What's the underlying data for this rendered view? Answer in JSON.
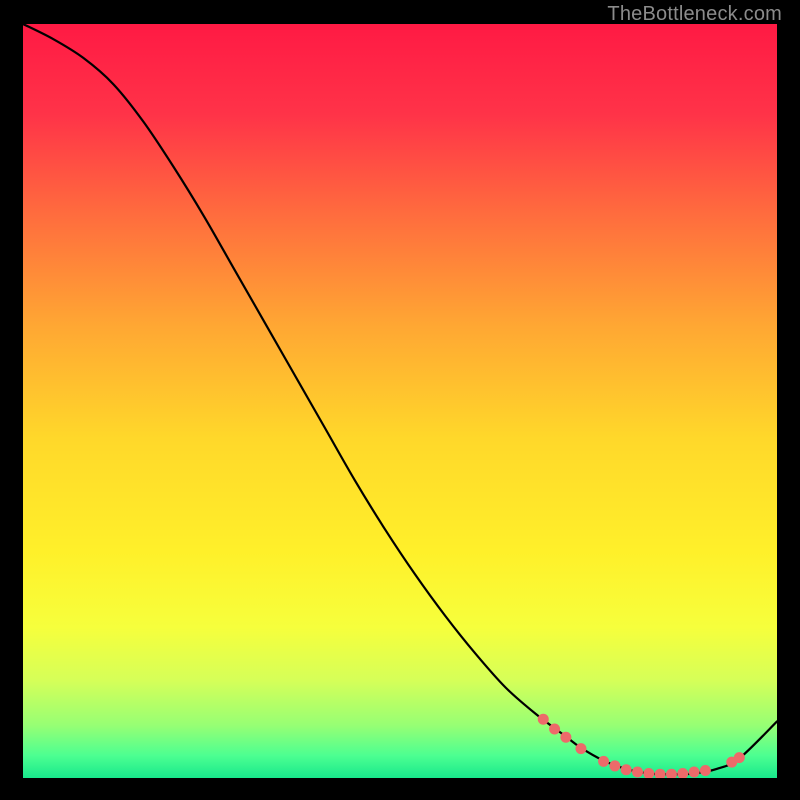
{
  "watermark": "TheBottleneck.com",
  "chart_data": {
    "type": "line",
    "title": "",
    "xlabel": "",
    "ylabel": "",
    "xlim": [
      0,
      100
    ],
    "ylim": [
      0,
      100
    ],
    "background_gradient": [
      {
        "pos": 0.0,
        "color": "#ff1a44"
      },
      {
        "pos": 0.12,
        "color": "#ff3348"
      },
      {
        "pos": 0.25,
        "color": "#ff6b3e"
      },
      {
        "pos": 0.4,
        "color": "#ffa733"
      },
      {
        "pos": 0.55,
        "color": "#ffd82a"
      },
      {
        "pos": 0.7,
        "color": "#fff02a"
      },
      {
        "pos": 0.8,
        "color": "#f6ff3c"
      },
      {
        "pos": 0.87,
        "color": "#d6ff58"
      },
      {
        "pos": 0.93,
        "color": "#97ff74"
      },
      {
        "pos": 0.97,
        "color": "#4dff91"
      },
      {
        "pos": 1.0,
        "color": "#18e88c"
      }
    ],
    "series": [
      {
        "name": "curve",
        "color": "#000000",
        "width": 2.2,
        "x": [
          0,
          4,
          8,
          12,
          16,
          20,
          24,
          28,
          32,
          36,
          40,
          44,
          48,
          52,
          56,
          60,
          64,
          68,
          72,
          74,
          77,
          80,
          83,
          86,
          89,
          92,
          95,
          100
        ],
        "y": [
          100,
          98,
          95.5,
          92,
          87,
          81,
          74.5,
          67.5,
          60.5,
          53.5,
          46.5,
          39.5,
          33,
          27,
          21.5,
          16.5,
          12,
          8.5,
          5.5,
          4,
          2.3,
          1.2,
          0.6,
          0.5,
          0.6,
          1.2,
          2.6,
          7.5
        ]
      }
    ],
    "marker_series": {
      "name": "highlight-dots",
      "color": "#ed6a6a",
      "radius": 5.5,
      "points": [
        {
          "x": 69.0,
          "y": 7.8
        },
        {
          "x": 70.5,
          "y": 6.5
        },
        {
          "x": 72.0,
          "y": 5.4
        },
        {
          "x": 74.0,
          "y": 3.9
        },
        {
          "x": 77.0,
          "y": 2.2
        },
        {
          "x": 78.5,
          "y": 1.6
        },
        {
          "x": 80.0,
          "y": 1.1
        },
        {
          "x": 81.5,
          "y": 0.8
        },
        {
          "x": 83.0,
          "y": 0.6
        },
        {
          "x": 84.5,
          "y": 0.5
        },
        {
          "x": 86.0,
          "y": 0.5
        },
        {
          "x": 87.5,
          "y": 0.6
        },
        {
          "x": 89.0,
          "y": 0.8
        },
        {
          "x": 90.5,
          "y": 1.0
        },
        {
          "x": 94.0,
          "y": 2.1
        },
        {
          "x": 95.0,
          "y": 2.7
        }
      ]
    }
  }
}
